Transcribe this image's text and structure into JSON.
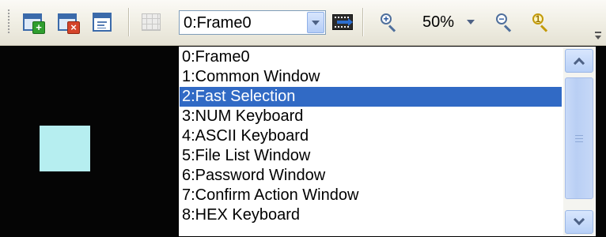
{
  "toolbar": {
    "frame_selected": "0:Frame0",
    "zoom_value": "50%"
  },
  "dropdown": {
    "items": [
      {
        "label": "0:Frame0"
      },
      {
        "label": "1:Common Window"
      },
      {
        "label": "2:Fast Selection"
      },
      {
        "label": "3:NUM Keyboard"
      },
      {
        "label": "4:ASCII Keyboard"
      },
      {
        "label": "5:File List Window"
      },
      {
        "label": "6:Password Window"
      },
      {
        "label": "7:Confirm Action Window"
      },
      {
        "label": "8:HEX Keyboard"
      }
    ],
    "selected_index": 2
  },
  "colors": {
    "selection": "#316ac5",
    "canvas": "#050505",
    "shape": "#b6eef0"
  },
  "icons": [
    "add-frame-icon",
    "delete-frame-icon",
    "frame-properties-icon",
    "grid-icon",
    "go-to-frame-icon",
    "zoom-in-icon",
    "zoom-out-icon",
    "zoom-reset-icon",
    "toolbar-overflow-icon"
  ]
}
